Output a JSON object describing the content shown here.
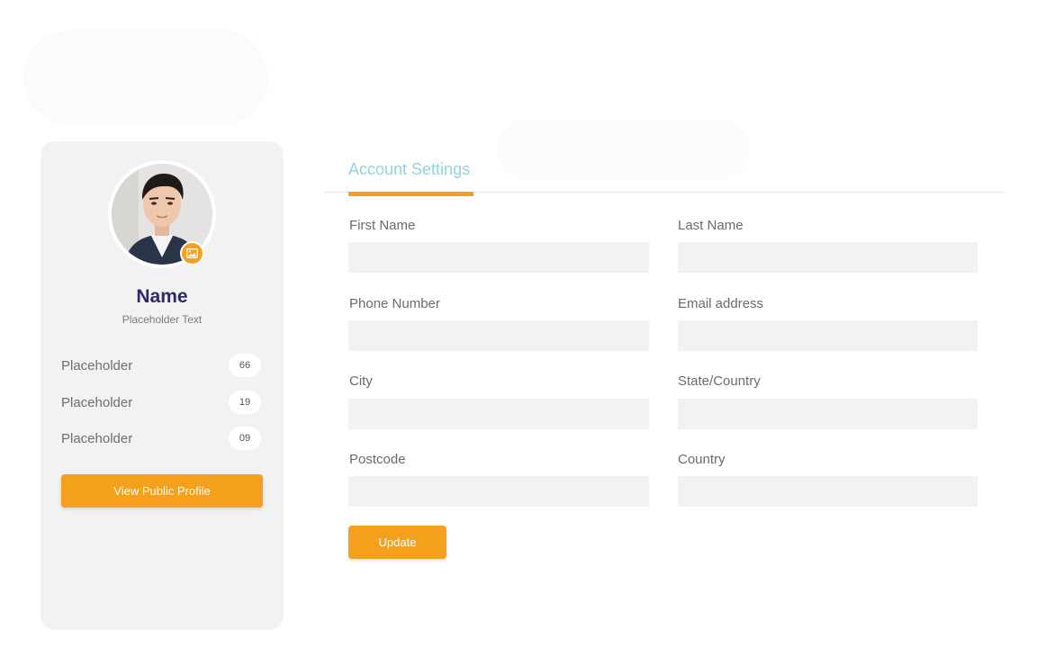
{
  "profile": {
    "name": "Name",
    "subtitle": "Placeholder Text",
    "stats": [
      {
        "label": "Placeholder",
        "count": "66"
      },
      {
        "label": "Placeholder",
        "count": "19"
      },
      {
        "label": "Placeholder",
        "count": "09"
      }
    ],
    "view_button_label": "View Public Profile",
    "badge_icon": "image-icon"
  },
  "tabs": {
    "active_label": "Account Settings"
  },
  "form": {
    "first_name": {
      "label": "First Name",
      "value": ""
    },
    "last_name": {
      "label": "Last Name",
      "value": ""
    },
    "phone": {
      "label": "Phone Number",
      "value": ""
    },
    "email": {
      "label": "Email address",
      "value": ""
    },
    "city": {
      "label": "City",
      "value": ""
    },
    "state": {
      "label": "State/Country",
      "value": ""
    },
    "postcode": {
      "label": "Postcode",
      "value": ""
    },
    "country": {
      "label": "Country",
      "value": ""
    },
    "update_label": "Update"
  },
  "colors": {
    "accent": "#f5a01d",
    "tab_text": "#8fd3de",
    "name_text": "#2b2a6b",
    "card_bg": "#f2f2f2"
  }
}
